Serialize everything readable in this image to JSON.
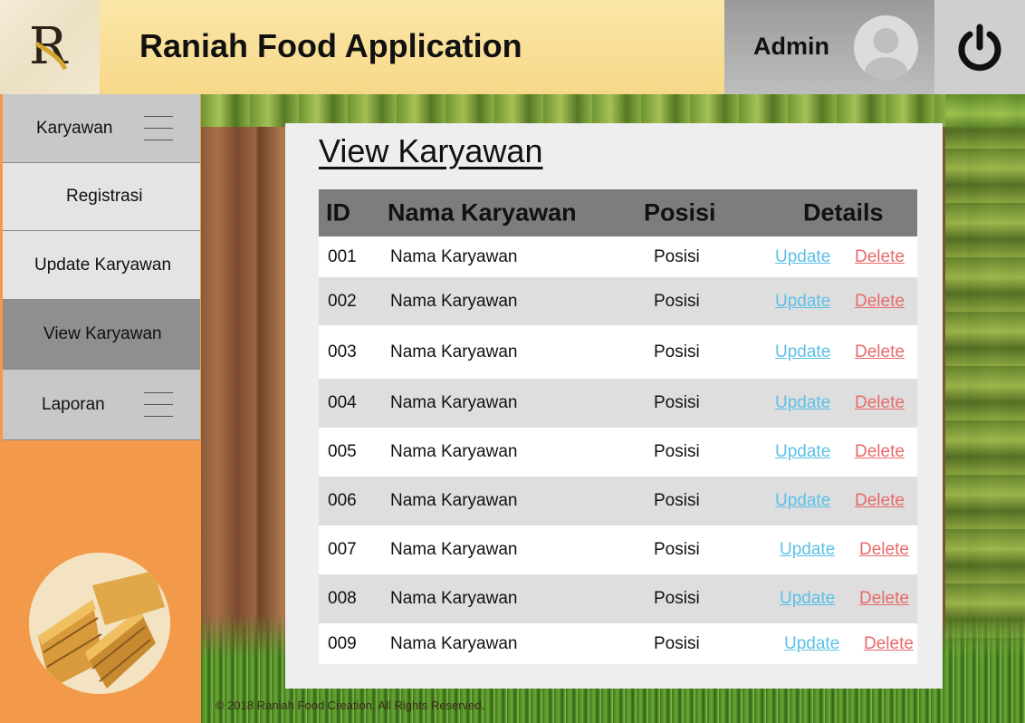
{
  "header": {
    "app_title": "Raniah Food Application",
    "user_label": "Admin",
    "logo_letter": "R"
  },
  "sidebar": {
    "items": [
      {
        "label": "Karyawan"
      },
      {
        "label": "Registrasi"
      },
      {
        "label": "Update Karyawan"
      },
      {
        "label": "View Karyawan"
      },
      {
        "label": "Laporan"
      }
    ]
  },
  "main": {
    "title": "View Karyawan",
    "table": {
      "headers": [
        "ID",
        "Nama Karyawan",
        "Posisi",
        "Details"
      ],
      "rows": [
        {
          "id": "001",
          "name": "Nama Karyawan",
          "posisi": "Posisi",
          "update": "Update",
          "delete": "Delete"
        },
        {
          "id": "002",
          "name": "Nama Karyawan",
          "posisi": "Posisi",
          "update": "Update",
          "delete": "Delete"
        },
        {
          "id": "003",
          "name": "Nama Karyawan",
          "posisi": "Posisi",
          "update": "Update",
          "delete": "Delete"
        },
        {
          "id": "004",
          "name": "Nama Karyawan",
          "posisi": "Posisi",
          "update": "Update",
          "delete": "Delete"
        },
        {
          "id": "005",
          "name": "Nama Karyawan",
          "posisi": "Posisi",
          "update": "Update",
          "delete": "Delete"
        },
        {
          "id": "006",
          "name": "Nama Karyawan",
          "posisi": "Posisi",
          "update": "Update",
          "delete": "Delete"
        },
        {
          "id": "007",
          "name": "Nama Karyawan",
          "posisi": "Posisi",
          "update": "Update",
          "delete": "Delete"
        },
        {
          "id": "008",
          "name": "Nama Karyawan",
          "posisi": "Posisi",
          "update": "Update",
          "delete": "Delete"
        },
        {
          "id": "009",
          "name": "Nama Karyawan",
          "posisi": "Posisi",
          "update": "Update",
          "delete": "Delete"
        }
      ]
    }
  },
  "footer": {
    "copyright": "© 2018 Raniah Food Creation. All Rights Reserved."
  },
  "colors": {
    "header_yellow": "#f7d889",
    "sidebar_orange": "#f39a4a",
    "active_nav": "#8f8f8f",
    "table_header": "#7d7d7d",
    "update_link": "#5cc0e8",
    "delete_link": "#e86a6a"
  },
  "icons": {
    "logo": "raniah-logo-icon",
    "avatar": "user-avatar-icon",
    "power": "power-icon",
    "menu": "hamburger-menu-icon"
  }
}
